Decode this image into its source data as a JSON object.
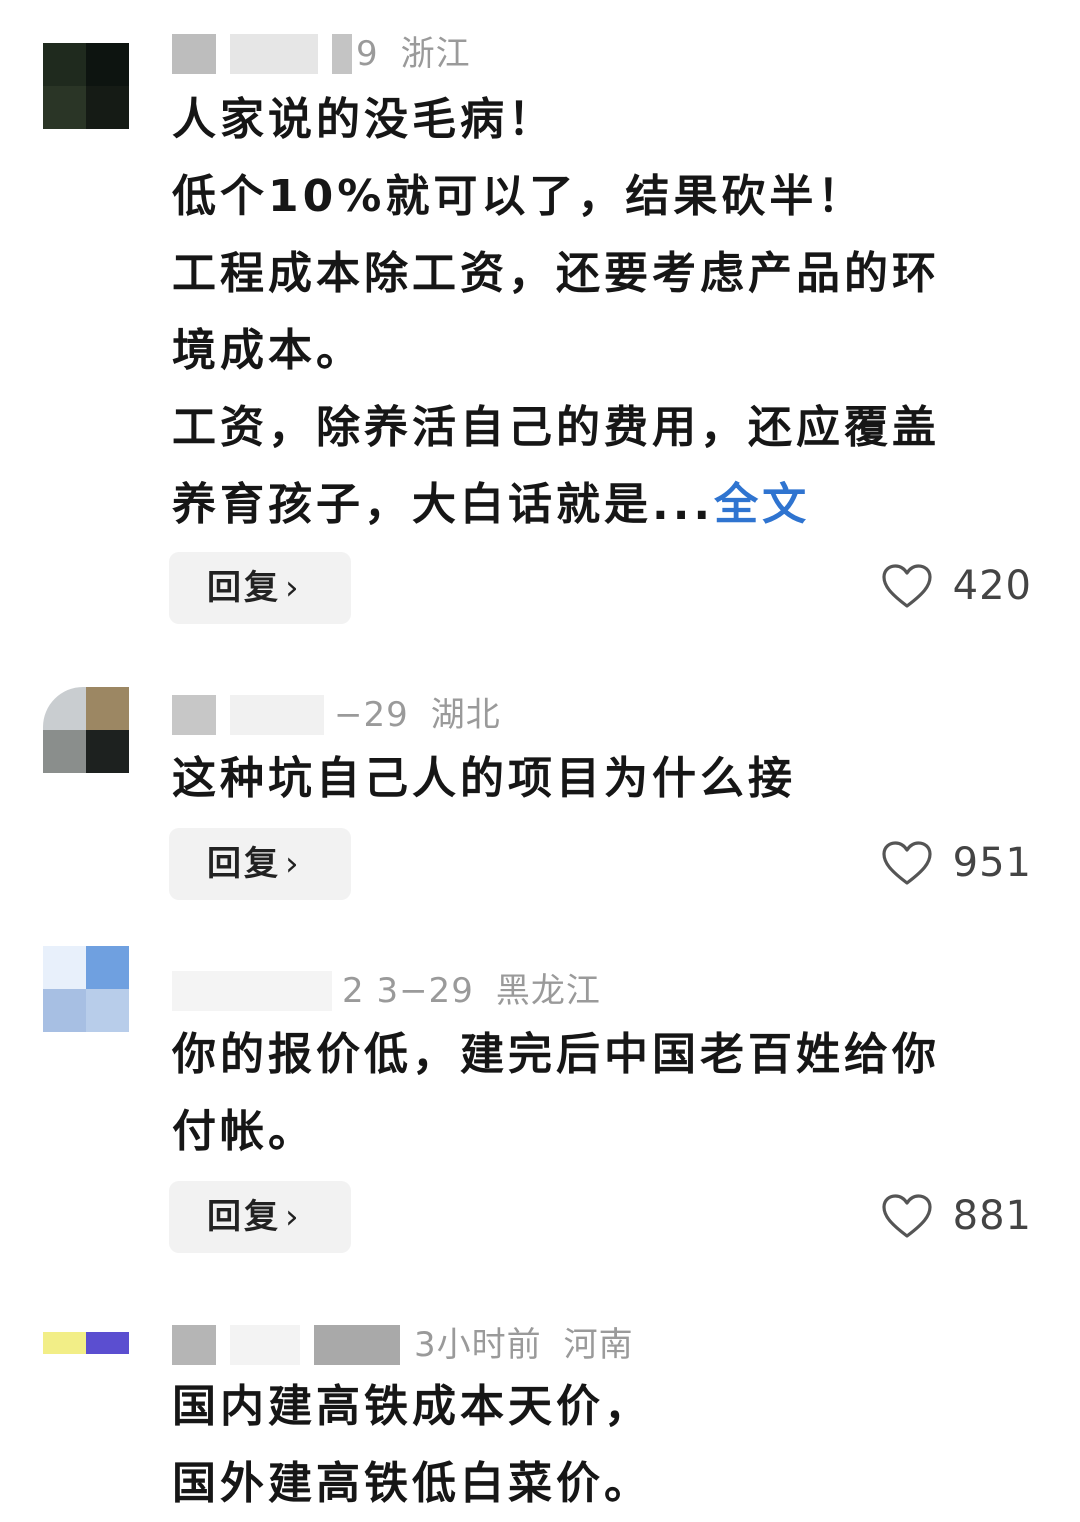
{
  "comments": [
    {
      "meta": {
        "date": "9",
        "location": "浙江"
      },
      "lines": [
        "人家说的没毛病！",
        "低个10%就可以了，结果砍半！",
        "工程成本除工资，还要考虑产品的环",
        "境成本。",
        "工资，除养活自己的费用，还应覆盖"
      ],
      "last_line": "养育孩子，大白话就是...",
      "more_label": "全文",
      "reply_label": "回复",
      "likes": "420"
    },
    {
      "meta": {
        "date": "−29",
        "location": "湖北"
      },
      "lines": [
        "这种坑自己人的项目为什么接"
      ],
      "reply_label": "回复",
      "likes": "951"
    },
    {
      "meta": {
        "date": "2  3−29",
        "location": "黑龙江"
      },
      "lines": [
        "你的报价低，建完后中国老百姓给你",
        "付帐。"
      ],
      "reply_label": "回复",
      "likes": "881"
    },
    {
      "meta": {
        "date": "3小时前",
        "location": "河南"
      },
      "lines": [
        "国内建高铁成本天价，",
        "国外建高铁低白菜价。"
      ]
    }
  ],
  "colors": {
    "link": "#2f74d0",
    "meta": "#9a9a9a",
    "button_bg": "#f2f2f2"
  },
  "icons": {
    "like": "heart-outline-icon",
    "reply_chevron": "chevron-right-icon"
  }
}
